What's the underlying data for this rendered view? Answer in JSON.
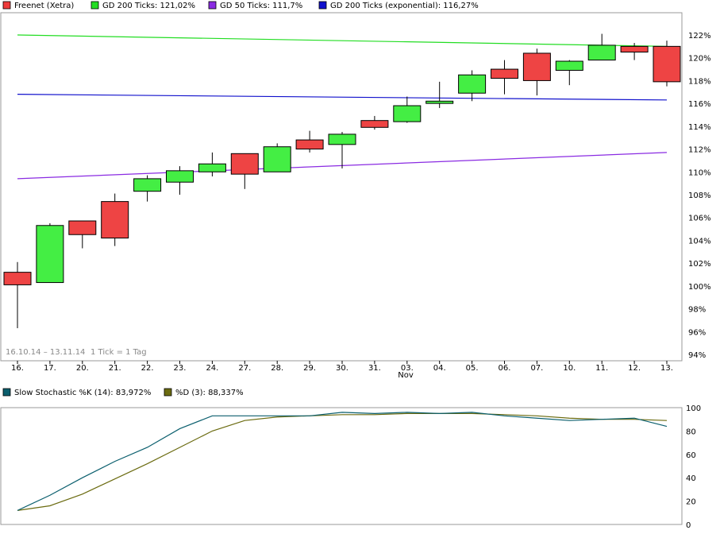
{
  "legend_main": [
    {
      "label": "Freenet (Xetra)",
      "color": "#ee3b3b"
    },
    {
      "label": "GD 200 Ticks: 121,02%",
      "color": "#22dd22"
    },
    {
      "label": "GD 50 Ticks: 111,7%",
      "color": "#8a2be2"
    },
    {
      "label": "GD 200 Ticks (exponential): 116,27%",
      "color": "#1010cc"
    }
  ],
  "legend_osc": [
    {
      "label": "Slow Stochastic %K (14): 83,972%",
      "color": "#0b5f6e"
    },
    {
      "label": "%D (3): 88,337%",
      "color": "#6b6b10"
    }
  ],
  "date_range": "16.10.14 – 13.11.14",
  "tick_info": "1 Tick = 1 Tag",
  "month_label": "Nov",
  "colors": {
    "up": "#44ee44",
    "down": "#ee4444",
    "outline": "#000000",
    "grid": "#cccccc"
  },
  "chart_data": [
    {
      "type": "candlestick",
      "title": "Freenet (Xetra)",
      "categories": [
        "16.",
        "17.",
        "20.",
        "21.",
        "22.",
        "23.",
        "24.",
        "27.",
        "28.",
        "29.",
        "30.",
        "31.",
        "03.",
        "04.",
        "05.",
        "06.",
        "07.",
        "10.",
        "11.",
        "12.",
        "13."
      ],
      "y_ticks": [
        "94%",
        "96%",
        "98%",
        "100%",
        "102%",
        "104%",
        "106%",
        "108%",
        "110%",
        "112%",
        "114%",
        "116%",
        "118%",
        "120%",
        "122%"
      ],
      "ylim": [
        94,
        123.5
      ],
      "unit": "%",
      "candles": [
        {
          "o": 101.2,
          "h": 102.1,
          "l": 96.3,
          "c": 100.1
        },
        {
          "o": 100.3,
          "h": 105.5,
          "l": 100.3,
          "c": 105.3
        },
        {
          "o": 105.7,
          "h": 105.7,
          "l": 103.3,
          "c": 104.5
        },
        {
          "o": 107.4,
          "h": 108.1,
          "l": 103.5,
          "c": 104.2
        },
        {
          "o": 108.3,
          "h": 109.7,
          "l": 107.4,
          "c": 109.4
        },
        {
          "o": 109.1,
          "h": 110.5,
          "l": 108.0,
          "c": 110.1
        },
        {
          "o": 110.0,
          "h": 111.7,
          "l": 109.6,
          "c": 110.7
        },
        {
          "o": 111.6,
          "h": 111.6,
          "l": 108.5,
          "c": 109.8
        },
        {
          "o": 110.0,
          "h": 112.5,
          "l": 110.0,
          "c": 112.2
        },
        {
          "o": 112.8,
          "h": 113.6,
          "l": 111.7,
          "c": 112.0
        },
        {
          "o": 112.4,
          "h": 113.5,
          "l": 110.3,
          "c": 113.3
        },
        {
          "o": 114.5,
          "h": 114.9,
          "l": 113.7,
          "c": 113.9
        },
        {
          "o": 114.4,
          "h": 116.6,
          "l": 114.3,
          "c": 115.8
        },
        {
          "o": 116.0,
          "h": 117.9,
          "l": 115.6,
          "c": 116.2
        },
        {
          "o": 116.9,
          "h": 118.9,
          "l": 116.2,
          "c": 118.5
        },
        {
          "o": 119.0,
          "h": 119.8,
          "l": 116.8,
          "c": 118.2
        },
        {
          "o": 120.4,
          "h": 120.8,
          "l": 116.7,
          "c": 118.0
        },
        {
          "o": 118.9,
          "h": 119.8,
          "l": 117.6,
          "c": 119.7
        },
        {
          "o": 119.8,
          "h": 122.1,
          "l": 119.8,
          "c": 121.1
        },
        {
          "o": 121.0,
          "h": 121.3,
          "l": 119.8,
          "c": 120.5
        },
        {
          "o": 121.0,
          "h": 121.5,
          "l": 117.5,
          "c": 117.9
        }
      ],
      "series": [
        {
          "name": "GD 200 Ticks",
          "start": 122.0,
          "end": 121.0
        },
        {
          "name": "GD 50 Ticks",
          "start": 109.4,
          "end": 111.7
        },
        {
          "name": "GD 200 Ticks (exponential)",
          "start": 116.8,
          "end": 116.3
        }
      ]
    },
    {
      "type": "line",
      "title": "Slow Stochastic",
      "y_ticks": [
        "0",
        "20",
        "40",
        "60",
        "80",
        "100"
      ],
      "ylim": [
        0,
        100
      ],
      "series": [
        {
          "name": "Slow Stochastic %K (14)",
          "values": [
            12,
            25,
            40,
            54,
            66,
            82,
            93,
            93,
            93,
            93,
            96,
            95,
            96,
            95,
            96,
            93,
            91,
            89,
            90,
            91,
            84
          ]
        },
        {
          "name": "%D (3)",
          "values": [
            12,
            16,
            26,
            39,
            52,
            66,
            80,
            89,
            92,
            93,
            94,
            94,
            95,
            95,
            95,
            94,
            93,
            91,
            90,
            90,
            89
          ]
        }
      ]
    }
  ]
}
